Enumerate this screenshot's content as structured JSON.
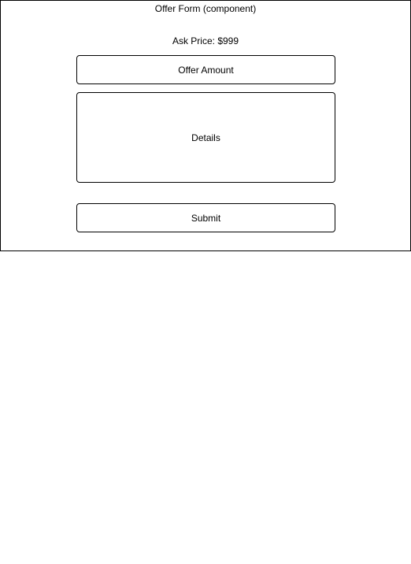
{
  "component": {
    "title": "Offer Form (component)",
    "ask_price": "Ask Price: $999",
    "offer_amount_label": "Offer Amount",
    "details_label": "Details",
    "submit_label": "Submit"
  }
}
